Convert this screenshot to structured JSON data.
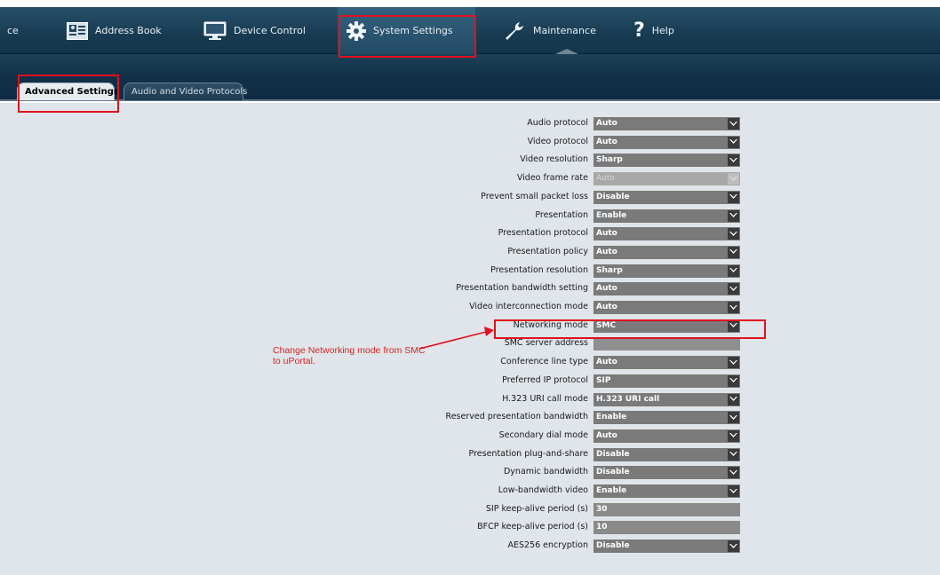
{
  "nav": {
    "partial_item": "ce",
    "items": [
      {
        "label": "Address Book",
        "icon": "address-book-icon"
      },
      {
        "label": "Device Control",
        "icon": "monitor-icon"
      },
      {
        "label": "System Settings",
        "icon": "gear-icon",
        "active": true
      },
      {
        "label": "Maintenance",
        "icon": "wrench-icon"
      },
      {
        "label": "Help",
        "icon": "question-icon"
      }
    ]
  },
  "tabs": [
    {
      "label": "Advanced Settings",
      "active": true
    },
    {
      "label": "Audio and Video Protocols",
      "active": false
    }
  ],
  "settings": [
    {
      "label": "Audio protocol",
      "value": "Auto",
      "type": "select"
    },
    {
      "label": "Video protocol",
      "value": "Auto",
      "type": "select"
    },
    {
      "label": "Video resolution",
      "value": "Sharp",
      "type": "select"
    },
    {
      "label": "Video frame rate",
      "value": "Auto",
      "type": "select-disabled"
    },
    {
      "label": "Prevent small packet loss",
      "value": "Disable",
      "type": "select"
    },
    {
      "label": "Presentation",
      "value": "Enable",
      "type": "select"
    },
    {
      "label": "Presentation protocol",
      "value": "Auto",
      "type": "select"
    },
    {
      "label": "Presentation policy",
      "value": "Auto",
      "type": "select"
    },
    {
      "label": "Presentation resolution",
      "value": "Sharp",
      "type": "select"
    },
    {
      "label": "Presentation bandwidth setting",
      "value": "Auto",
      "type": "select"
    },
    {
      "label": "Video interconnection mode",
      "value": "Auto",
      "type": "select"
    },
    {
      "label": "Networking mode",
      "value": "SMC",
      "type": "select"
    },
    {
      "label": "SMC server address",
      "value": "",
      "type": "text"
    },
    {
      "label": "Conference line type",
      "value": "Auto",
      "type": "select"
    },
    {
      "label": "Preferred IP protocol",
      "value": "SIP",
      "type": "select"
    },
    {
      "label": "H.323 URI call mode",
      "value": "H.323 URI call",
      "type": "select"
    },
    {
      "label": "Reserved presentation bandwidth",
      "value": "Enable",
      "type": "select"
    },
    {
      "label": "Secondary dial mode",
      "value": "Auto",
      "type": "select"
    },
    {
      "label": "Presentation plug-and-share",
      "value": "Disable",
      "type": "select"
    },
    {
      "label": "Dynamic bandwidth",
      "value": "Disable",
      "type": "select"
    },
    {
      "label": "Low-bandwidth video",
      "value": "Enable",
      "type": "select"
    },
    {
      "label": "SIP keep-alive period (s)",
      "value": "30",
      "type": "text"
    },
    {
      "label": "BFCP keep-alive period (s)",
      "value": "10",
      "type": "text"
    },
    {
      "label": "AES256 encryption",
      "value": "Disable",
      "type": "select"
    }
  ],
  "annotation": {
    "text": "Change Networking mode from SMC to uPortal.",
    "color": "#d8241f"
  },
  "colors": {
    "highlight": "#e0111c",
    "nav_bg": "#183b52",
    "field_bg": "#7a7a7a",
    "content_bg": "#dfe5ea"
  }
}
